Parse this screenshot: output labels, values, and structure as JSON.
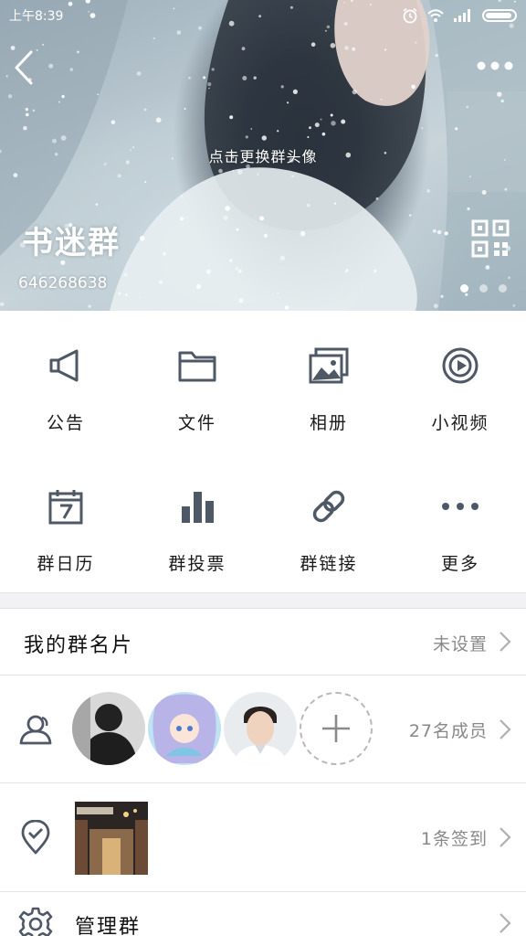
{
  "status_bar": {
    "time": "上午8:39"
  },
  "header": {
    "change_avatar_hint": "点击更换群头像",
    "group_name": "书迷群",
    "group_id": "646268638",
    "page_dots": 3,
    "active_dot": 0
  },
  "features": [
    {
      "label": "公告",
      "icon": "megaphone-icon"
    },
    {
      "label": "文件",
      "icon": "folder-icon"
    },
    {
      "label": "相册",
      "icon": "photo-album-icon"
    },
    {
      "label": "小视频",
      "icon": "video-icon"
    },
    {
      "label": "群日历",
      "icon": "calendar-icon"
    },
    {
      "label": "群投票",
      "icon": "bar-chart-icon"
    },
    {
      "label": "群链接",
      "icon": "link-icon"
    },
    {
      "label": "更多",
      "icon": "more-dots-icon"
    }
  ],
  "rows": {
    "card": {
      "title": "我的群名片",
      "value": "未设置"
    },
    "members": {
      "value": "27名成员",
      "icon": "members-icon"
    },
    "checkin": {
      "value": "1条签到",
      "icon": "location-check-icon"
    },
    "manage": {
      "title": "管理群",
      "icon": "gear-icon"
    }
  },
  "colors": {
    "icon": "#4f5866",
    "text": "#1a1a1a",
    "secondary_text": "#888888",
    "divider": "#e2e2e4",
    "section_gap": "#f2f2f4"
  }
}
